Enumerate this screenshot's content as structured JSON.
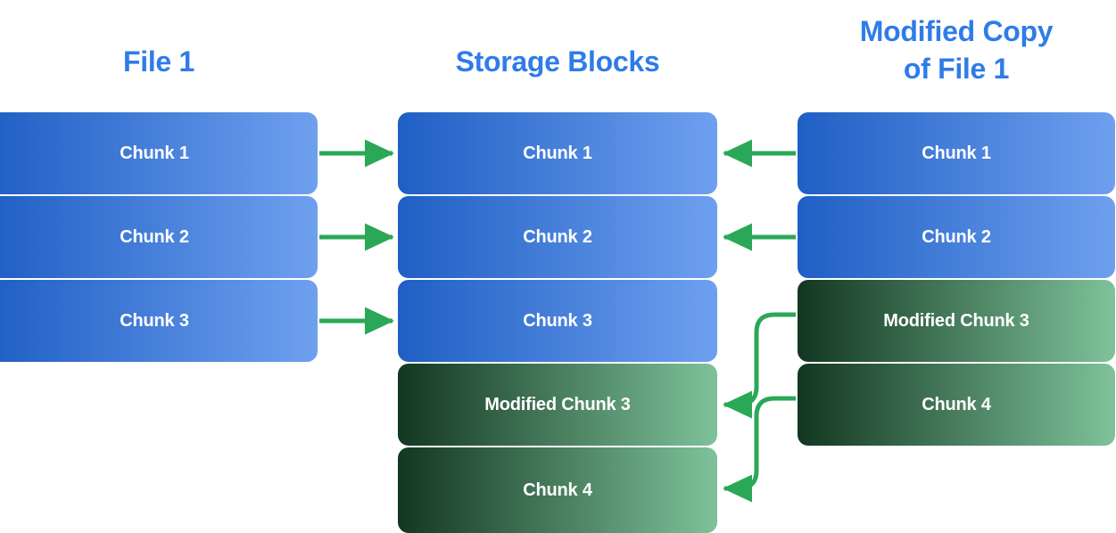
{
  "diagram": {
    "type": "deduplication-block-storage",
    "background_color": "#ffffff",
    "title_color": "#2f7ce8",
    "arrow_color": "#2ba857",
    "blue_gradient": [
      "#1f5fc4",
      "#6ea0ef"
    ],
    "green_gradient": [
      "#123720",
      "#7ec29b"
    ],
    "columns": [
      {
        "id": "file1",
        "title": "File 1",
        "blocks": [
          {
            "label": "Chunk 1",
            "color": "blue"
          },
          {
            "label": "Chunk 2",
            "color": "blue"
          },
          {
            "label": "Chunk 3",
            "color": "blue"
          }
        ]
      },
      {
        "id": "storage-blocks",
        "title": "Storage Blocks",
        "blocks": [
          {
            "label": "Chunk 1",
            "color": "blue"
          },
          {
            "label": "Chunk 2",
            "color": "blue"
          },
          {
            "label": "Chunk 3",
            "color": "blue"
          },
          {
            "label": "Modified Chunk 3",
            "color": "green"
          },
          {
            "label": "Chunk 4",
            "color": "green"
          }
        ]
      },
      {
        "id": "modified-copy-of-file1",
        "title": "Modified Copy\nof File 1",
        "blocks": [
          {
            "label": "Chunk 1",
            "color": "blue"
          },
          {
            "label": "Chunk 2",
            "color": "blue"
          },
          {
            "label": "Modified Chunk 3",
            "color": "green"
          },
          {
            "label": "Chunk 4",
            "color": "green"
          }
        ]
      }
    ],
    "connections": [
      {
        "name": "file1-chunk1-to-storage-chunk1",
        "from": "file1.0",
        "to": "storage.0",
        "style": "straight-right"
      },
      {
        "name": "file1-chunk2-to-storage-chunk2",
        "from": "file1.1",
        "to": "storage.1",
        "style": "straight-right"
      },
      {
        "name": "file1-chunk3-to-storage-chunk3",
        "from": "file1.2",
        "to": "storage.2",
        "style": "straight-right"
      },
      {
        "name": "copy-chunk1-to-storage-chunk1",
        "from": "copy.0",
        "to": "storage.0",
        "style": "straight-left"
      },
      {
        "name": "copy-chunk2-to-storage-chunk2",
        "from": "copy.1",
        "to": "storage.1",
        "style": "straight-left"
      },
      {
        "name": "copy-modified-chunk3-to-storage-modified-chunk3",
        "from": "copy.2",
        "to": "storage.3",
        "style": "curved-left-down"
      },
      {
        "name": "copy-chunk4-to-storage-chunk4",
        "from": "copy.3",
        "to": "storage.4",
        "style": "curved-left-down"
      }
    ]
  }
}
